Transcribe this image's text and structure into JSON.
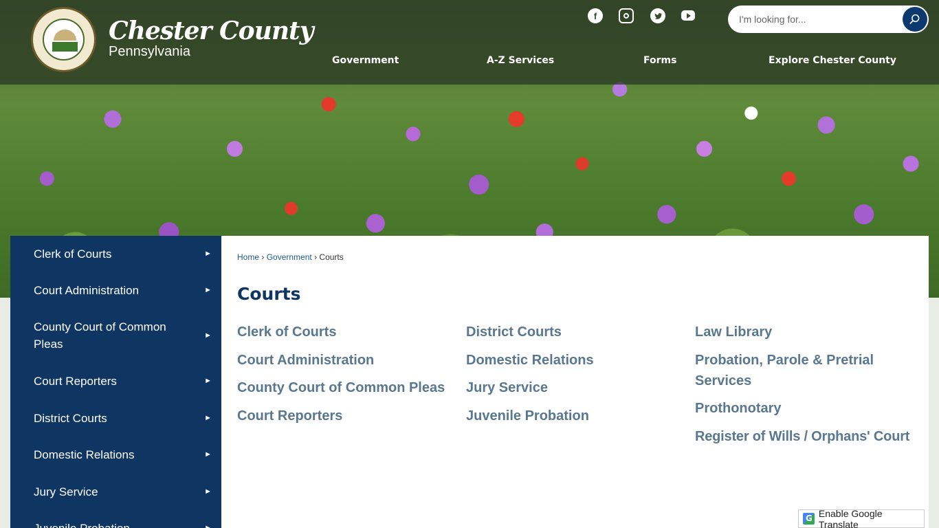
{
  "brand": {
    "name": "Chester County",
    "subtitle": "Pennsylvania"
  },
  "social": {
    "facebook": "f"
  },
  "search": {
    "placeholder": "I'm looking for..."
  },
  "nav": {
    "items": [
      {
        "label": "Government"
      },
      {
        "label": "A-Z Services"
      },
      {
        "label": "Forms"
      },
      {
        "label": "Explore Chester County"
      }
    ]
  },
  "sidebar": {
    "items": [
      {
        "label": "Clerk of Courts"
      },
      {
        "label": "Court Administration"
      },
      {
        "label": "County Court of Common Pleas"
      },
      {
        "label": "Court Reporters"
      },
      {
        "label": "District Courts"
      },
      {
        "label": "Domestic Relations"
      },
      {
        "label": "Jury Service"
      },
      {
        "label": "Juvenile Probation"
      }
    ],
    "arrow": "►"
  },
  "breadcrumb": {
    "home": "Home",
    "sep": "›",
    "government": "Government",
    "current": "Courts"
  },
  "page": {
    "title": "Courts"
  },
  "links": {
    "col1": [
      "Clerk of Courts",
      "Court Administration",
      "County Court of Common Pleas",
      "Court Reporters"
    ],
    "col2": [
      "District Courts",
      "Domestic Relations",
      "Jury Service",
      "Juvenile Probation"
    ],
    "col3": [
      "Law Library",
      "Probation, Parole & Pretrial Services",
      "Prothonotary",
      "Register of Wills / Orphans' Court"
    ]
  },
  "translate": {
    "label": "Enable Google Translate",
    "icon_letter": "G"
  }
}
